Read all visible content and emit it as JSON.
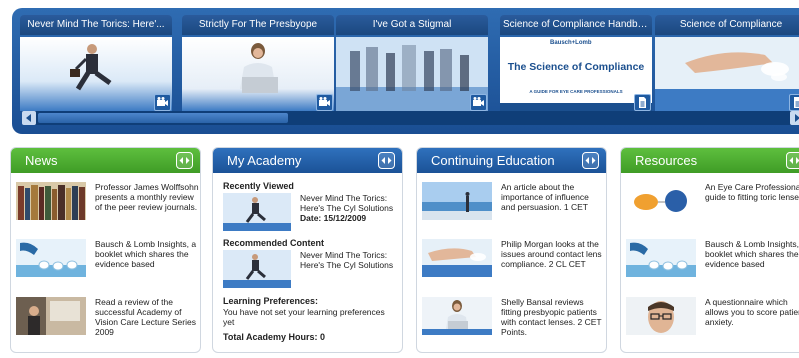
{
  "carousel": {
    "slides": [
      {
        "title": "Never Mind The Torics: Here'...",
        "thumb": "businessman-jumping-image",
        "type": "video"
      },
      {
        "title": "Strictly For The Presbyope",
        "thumb": "woman-laptop-image",
        "type": "video"
      },
      {
        "title": "I've Got a Stigmal",
        "thumb": "crowd-blur-image",
        "type": "video"
      },
      {
        "title": "Science of Compliance Handbook",
        "thumb": "handbook-cover-image",
        "type": "document",
        "cover": {
          "brand": "Bausch+Lomb",
          "heading": "The Science of Compliance",
          "footer": "A GUIDE FOR EYE CARE PROFESSIONALS"
        }
      },
      {
        "title": "Science of Compliance",
        "thumb": "hand-water-image",
        "type": "document"
      }
    ]
  },
  "panels": {
    "news": {
      "title": "News",
      "items": [
        {
          "text": "Professor James Wolffsohn presents a monthly review of the peer review journals.",
          "thumb": "books-image"
        },
        {
          "text": "Bausch & Lomb Insights, a booklet which shares the evidence based",
          "thumb": "lab-hand-image"
        },
        {
          "text": "Read a review of the successful Academy of Vision Care Lecture Series 2009",
          "thumb": "lecture-image"
        }
      ]
    },
    "academy": {
      "title": "My Academy",
      "recently_viewed_label": "Recently Viewed",
      "recently_viewed_title": "Never Mind The Torics: Here's The Cyl Solutions",
      "recently_viewed_date": "Date: 15/12/2009",
      "recommended_label": "Recommended Content",
      "recommended_title": "Never Mind The Torics: Here's The Cyl Solutions",
      "preferences_label": "Learning Preferences:",
      "preferences_text": "You have not set your learning preferences yet",
      "total_hours": "Total Academy Hours: 0"
    },
    "ce": {
      "title": "Continuing Education",
      "items": [
        {
          "text": "An article about the importance of influence and persuasion. 1 CET",
          "thumb": "beach-image"
        },
        {
          "text": "Philip Morgan looks at the issues around contact lens compliance. 2 CL CET",
          "thumb": "hand-water-image"
        },
        {
          "text": "Shelly Bansal reviews fitting presbyopic patients with contact lenses. 2 CET Points.",
          "thumb": "woman-laptop-image"
        }
      ]
    },
    "resources": {
      "title": "Resources",
      "items": [
        {
          "text": "An Eye Care Professional's guide to fitting toric lenses.",
          "thumb": "lens-diagram-image"
        },
        {
          "text": "Bausch & Lomb Insights, a booklet which shares the evidence based",
          "thumb": "lab-hand-image"
        },
        {
          "text": "A questionnaire which allows you to score patient anxiety.",
          "thumb": "man-glasses-image"
        }
      ]
    }
  }
}
